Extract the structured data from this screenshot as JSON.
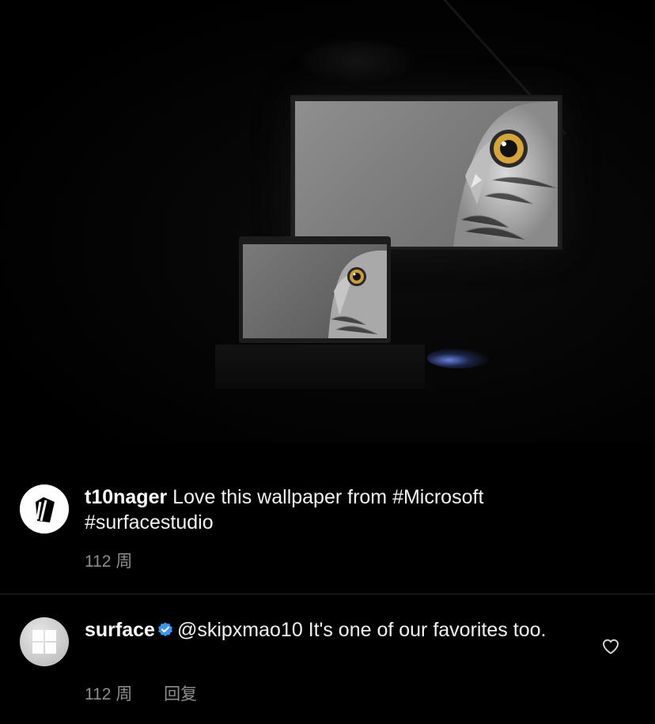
{
  "post": {
    "image": "dark-desk-setup-owl-wallpaper"
  },
  "comments": [
    {
      "username": "t10nager",
      "text": "Love this wallpaper from #Microsoft #surfacestudio",
      "time": "112 周",
      "avatar": "t10nager-logo"
    },
    {
      "username": "surface",
      "verified": true,
      "mention": "@skipxmao10",
      "text": "It's one of our favorites too.",
      "time": "112 周",
      "reply_label": "回复",
      "avatar": "windows-logo",
      "like_icon": "heart-outline-icon"
    }
  ],
  "colors": {
    "background": "#000000",
    "verified": "#3897f0",
    "meta_text": "#8e8e8e"
  }
}
